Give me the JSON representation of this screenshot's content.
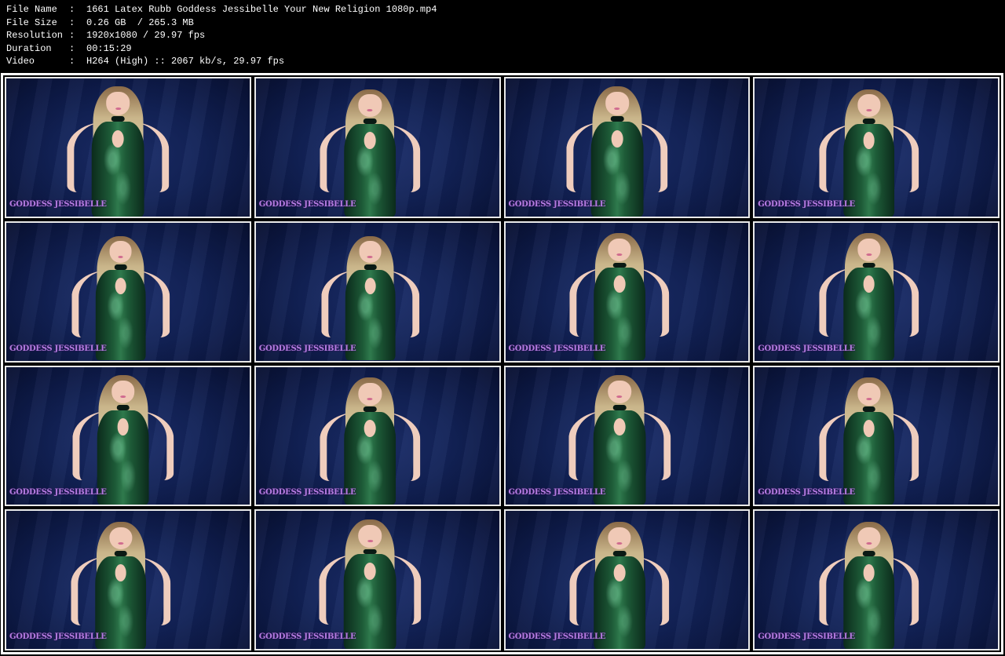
{
  "info": [
    {
      "key": "File Name",
      "value": "1661 Latex Rubb Goddess Jessibelle Your New Religion 1080p.mp4"
    },
    {
      "key": "File Size",
      "value": "0.26 GB  / 265.3 MB"
    },
    {
      "key": "Resolution",
      "value": "1920x1080 / 29.97 fps"
    },
    {
      "key": "Duration",
      "value": "00:15:29"
    },
    {
      "key": "Video",
      "value": "H264 (High) :: 2067 kb/s, 29.97 fps"
    }
  ],
  "watermark": "GODDESS JESSIBELLE",
  "thumbnails": [
    {
      "pos": "center"
    },
    {
      "pos": "center"
    },
    {
      "pos": "center"
    },
    {
      "pos": "center"
    },
    {
      "pos": "center"
    },
    {
      "pos": "center"
    },
    {
      "pos": "center"
    },
    {
      "pos": "center"
    },
    {
      "pos": "center"
    },
    {
      "pos": "center"
    },
    {
      "pos": "center"
    },
    {
      "pos": "center"
    },
    {
      "pos": "center"
    },
    {
      "pos": "center"
    },
    {
      "pos": "center"
    },
    {
      "pos": "center"
    }
  ],
  "colors": {
    "background": "#000000",
    "text": "#ffffff",
    "watermark": "#b47ce0",
    "backdrop": "#122257",
    "dress": "#1d5a37"
  }
}
